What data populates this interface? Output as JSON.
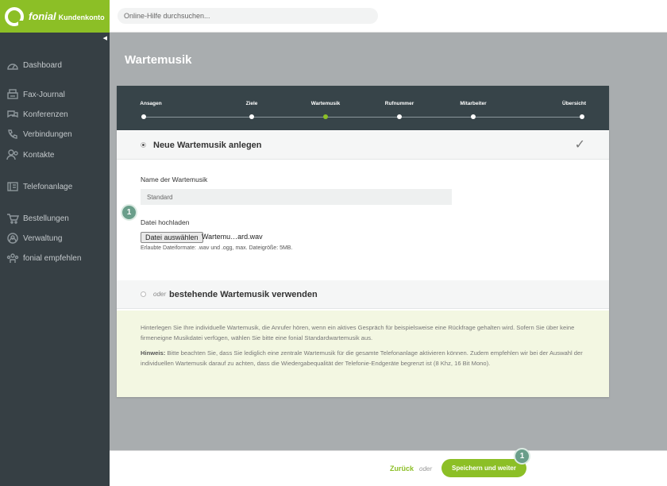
{
  "brand": {
    "name": "fonial",
    "sub": "Kundenkonto"
  },
  "search": {
    "placeholder": "Online-Hilfe durchsuchen..."
  },
  "sidebar": {
    "collapse_glyph": "◀",
    "items": [
      {
        "label": "Dashboard",
        "icon": "dashboard-icon"
      },
      {
        "label": "Fax-Journal",
        "icon": "fax-icon"
      },
      {
        "label": "Konferenzen",
        "icon": "conference-icon"
      },
      {
        "label": "Verbindungen",
        "icon": "phone-icon"
      },
      {
        "label": "Kontakte",
        "icon": "contacts-icon"
      },
      {
        "label": "Telefonanlage",
        "icon": "pbx-icon"
      },
      {
        "label": "Bestellungen",
        "icon": "cart-icon"
      },
      {
        "label": "Verwaltung",
        "icon": "account-icon"
      },
      {
        "label": "fonial empfehlen",
        "icon": "recommend-icon"
      }
    ]
  },
  "page": {
    "title": "Wartemusik"
  },
  "wizard": {
    "steps": [
      {
        "label": "Ansagen"
      },
      {
        "label": "Ziele"
      },
      {
        "label": "Wartemusik"
      },
      {
        "label": "Rufnummer"
      },
      {
        "label": "Mitarbeiter"
      },
      {
        "label": "Übersicht"
      }
    ],
    "active_step": "Wartemusik"
  },
  "new_section": {
    "title": "Neue Wartemusik anlegen",
    "check_glyph": "✓",
    "name_label": "Name der Wartemusik",
    "name_value": "Standard",
    "upload_label": "Datei hochladen",
    "file_button": "Datei auswählen",
    "file_name": "Wartemu…ard.wav",
    "formats_hint": "Erlaubte Dateiformate: .wav und .ogg, max. Dateigröße: 5MB."
  },
  "existing_section": {
    "prefix": "oder",
    "title": "bestehende Wartemusik verwenden"
  },
  "info": {
    "text1": "Hinterlegen Sie Ihre individuelle Wartemusik, die Anrufer hören, wenn ein aktives Gespräch für beispielsweise eine Rückfrage gehalten wird. Sofern Sie über keine firmeneigne Musikdatei verfügen, wählen Sie bitte eine fonial Standardwartemusik aus.",
    "hint_label": "Hinweis:",
    "hint_text": " Bitte beachten Sie, dass Sie lediglich eine zentrale Wartemusik für die gesamte Telefonanlage aktivieren können. Zudem empfehlen wir bei der Auswahl der individuellen Wartemusik darauf zu achten, dass die Wiedergabequalität der Telefonie-Endgeräte begrenzt ist (8 Khz, 16 Bit Mono)."
  },
  "badges": [
    "1",
    "1"
  ],
  "footer": {
    "back": "Zurück",
    "oder": "oder",
    "save": "Speichern und weiter"
  },
  "colors": {
    "accent": "#8cbf26",
    "sidebar": "#363f44",
    "stepbar": "#374449",
    "badge": "#6a9e8a"
  }
}
